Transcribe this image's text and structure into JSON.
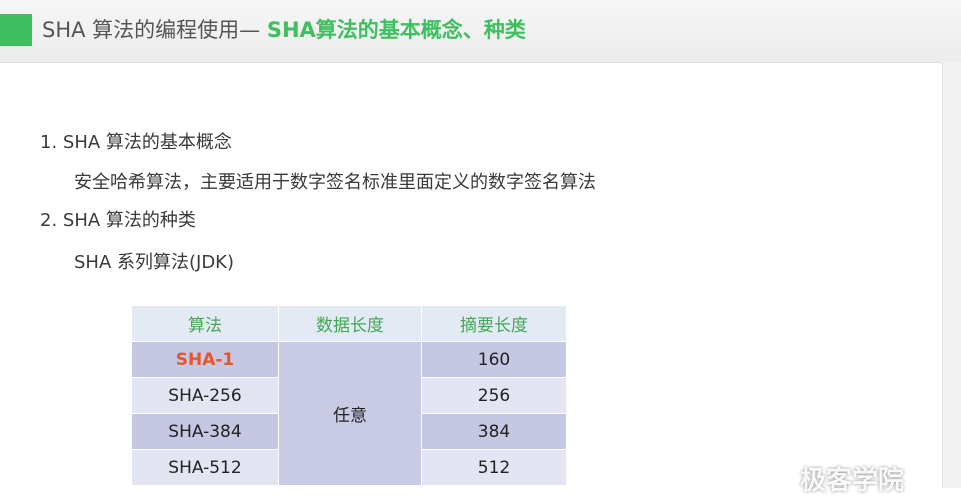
{
  "header": {
    "title_plain": "SHA 算法的编程使用— ",
    "title_highlight": "SHA算法的基本概念、种类"
  },
  "content": {
    "item1_title": "1. SHA 算法的基本概念",
    "item1_desc": "安全哈希算法，主要适用于数字签名标准里面定义的数字签名算法",
    "item2_title": "2. SHA 算法的种类",
    "item2_desc": "SHA 系列算法(JDK)"
  },
  "table": {
    "headers": [
      "算法",
      "数据长度",
      "摘要长度"
    ],
    "merged_data_length": "任意",
    "rows": [
      {
        "algorithm": "SHA-1",
        "digest": "160"
      },
      {
        "algorithm": "SHA-256",
        "digest": "256"
      },
      {
        "algorithm": "SHA-384",
        "digest": "384"
      },
      {
        "algorithm": "SHA-512",
        "digest": "512"
      }
    ]
  },
  "watermark": "极客学院",
  "colors": {
    "accent": "#3fbf5f",
    "header_text": "#3fa955",
    "highlight_row_text": "#e8552a",
    "row_dark": "#c5c7e3",
    "row_light": "#e4e5f3"
  }
}
